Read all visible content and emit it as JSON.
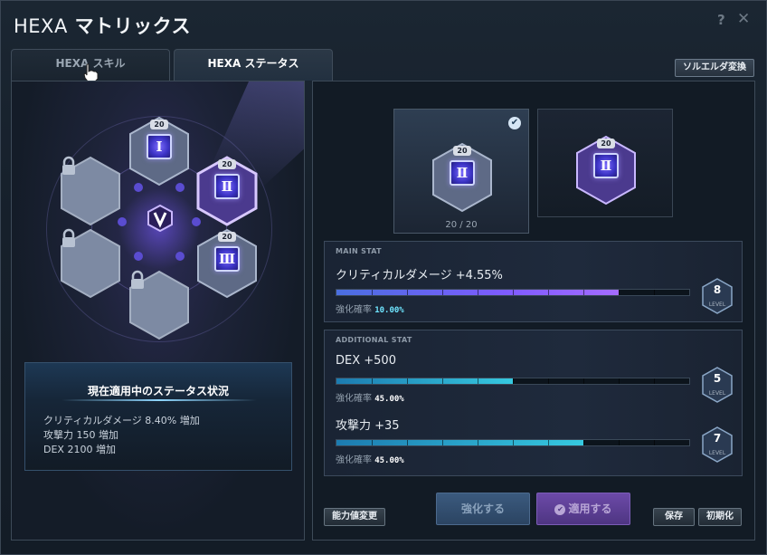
{
  "window": {
    "title_prefix": "HEXA",
    "title_main": "マトリックス",
    "help": "?",
    "close": "✕"
  },
  "tabs": [
    {
      "label": "HEXA スキル"
    },
    {
      "label": "HEXA ステータス"
    }
  ],
  "convert_button": "ソルエルダ変換",
  "matrix": {
    "nodes": [
      {
        "level": "20",
        "numeral": "Ⅰ"
      },
      {
        "level": "20",
        "numeral": "Ⅱ"
      },
      {
        "level": "20",
        "numeral": "Ⅲ"
      }
    ]
  },
  "current_status": {
    "title": "現在適用中のステータス状況",
    "lines": [
      "クリティカルダメージ 8.40% 増加",
      "攻撃力 150 増加",
      "DEX 2100 増加"
    ]
  },
  "slots": {
    "left": {
      "level": "20",
      "numeral": "Ⅱ",
      "exp": "20 / 20"
    },
    "right": {
      "level": "20",
      "numeral": "Ⅱ"
    }
  },
  "main_stat": {
    "section_label": "MAIN STAT",
    "name": "クリティカルダメージ +4.55%",
    "rate_label": "強化確率",
    "rate_value": "10.00%",
    "level": "8",
    "level_caption": "LEVEL",
    "progress": 0.8
  },
  "additional_stat": {
    "section_label": "ADDITIONAL STAT",
    "stats": [
      {
        "name": "DEX +500",
        "rate_label": "強化確率",
        "rate_value": "45.00%",
        "level": "5",
        "level_caption": "LEVEL",
        "progress": 0.5
      },
      {
        "name": "攻撃力 +35",
        "rate_label": "強化確率",
        "rate_value": "45.00%",
        "level": "7",
        "level_caption": "LEVEL",
        "progress": 0.7
      }
    ]
  },
  "buttons": {
    "ability_change": "能力値変更",
    "enhance": "強化する",
    "apply": "適用する",
    "save": "保存",
    "reset": "初期化"
  }
}
